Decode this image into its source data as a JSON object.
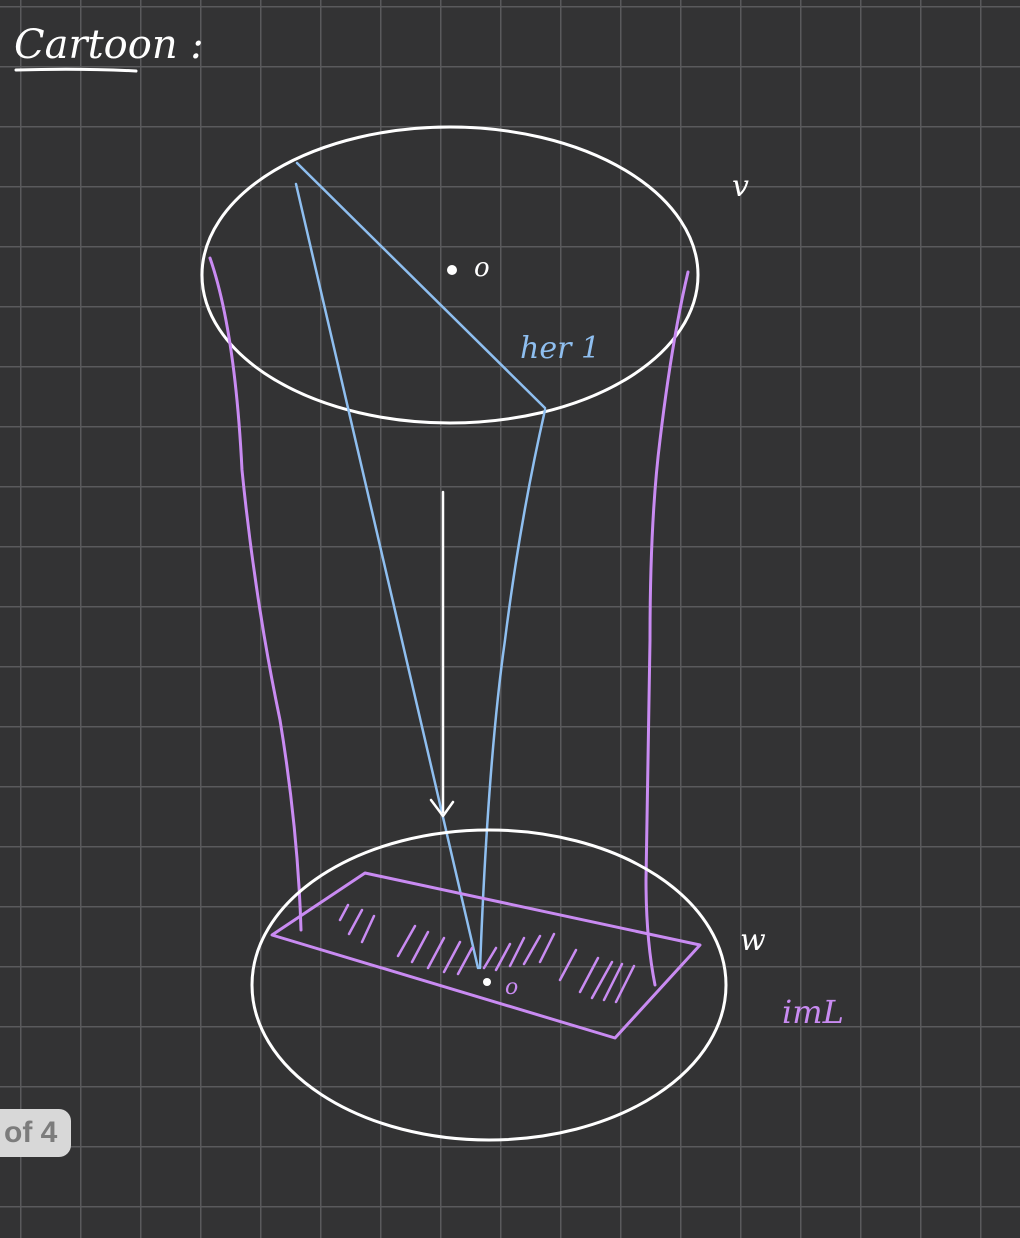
{
  "note": {
    "title": "Cartoon :",
    "labels": {
      "top_point": "o",
      "top_right": "v",
      "blue_segment": "her 1",
      "bottom_point": "o",
      "bottom_right": "w",
      "image_label": "imL"
    },
    "colors": {
      "background": "#333334",
      "grid": "#5a5a5c",
      "white_ink": "#ffffff",
      "blue_ink": "#8fbff0",
      "purple_ink": "#c98bf2"
    }
  },
  "pager": {
    "label": "of 4"
  }
}
